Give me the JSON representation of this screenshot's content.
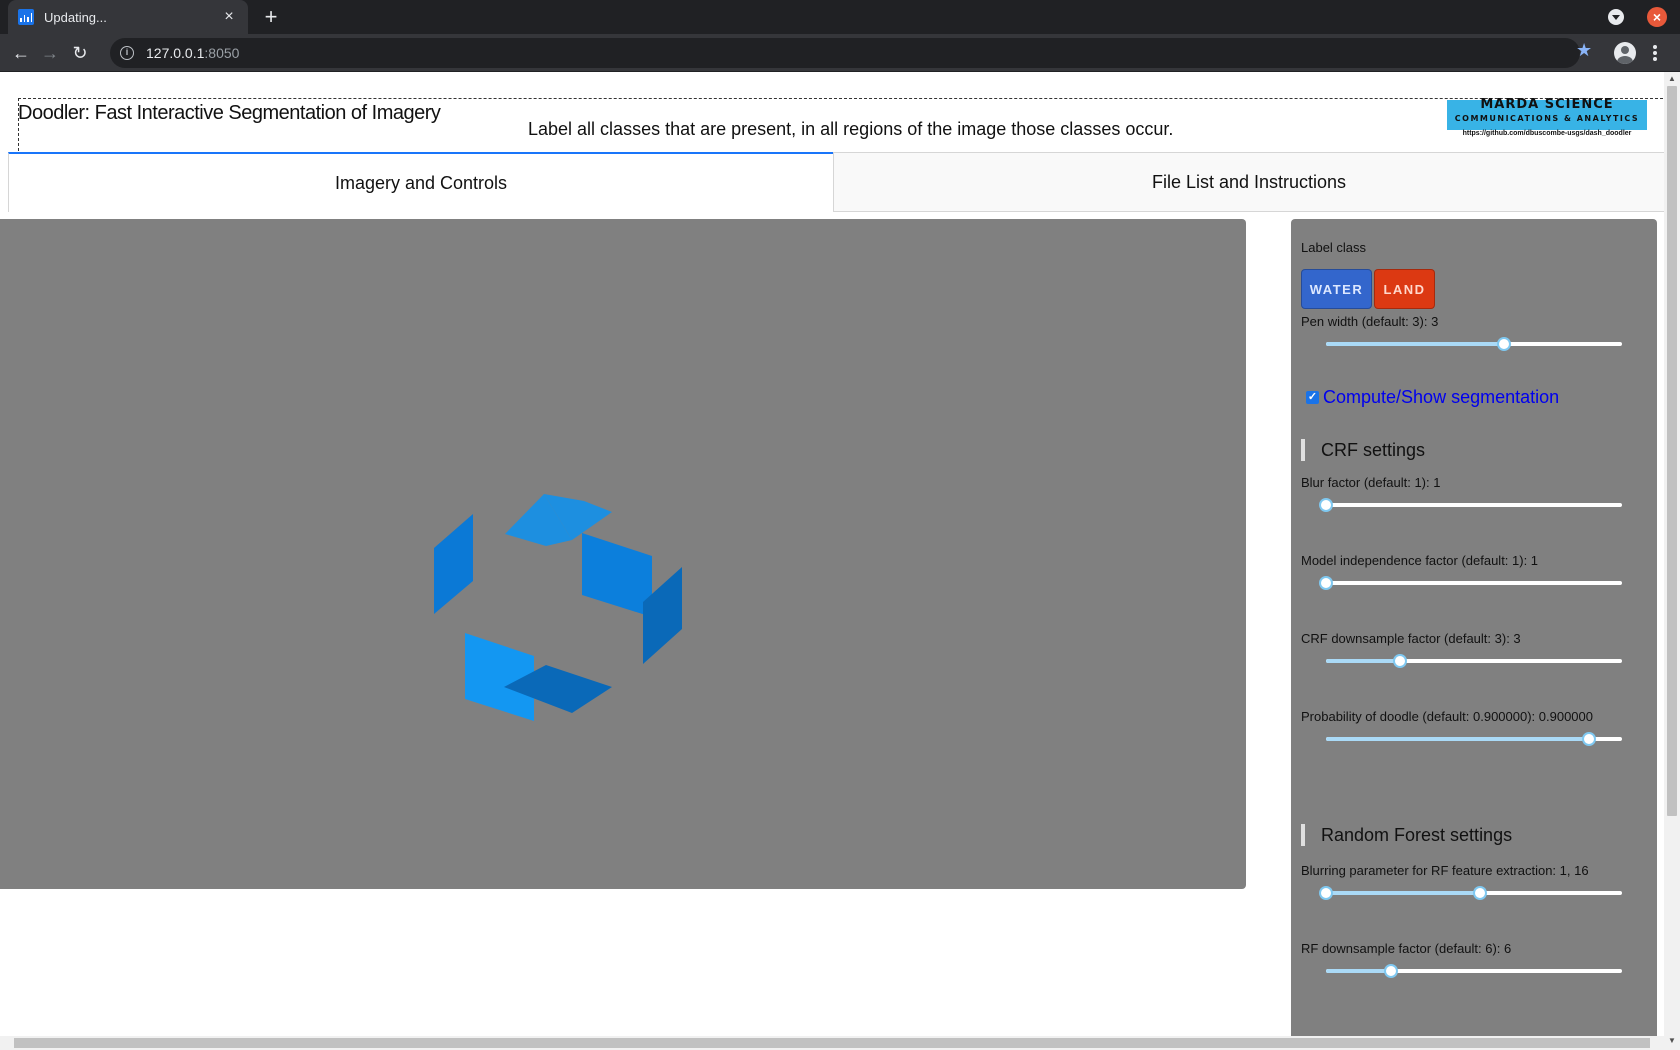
{
  "browser": {
    "tab_title": "Updating...",
    "tab_close": "×",
    "new_tab": "+",
    "url_host": "127.0.0.1",
    "url_port": ":8050",
    "window_close": "×"
  },
  "header": {
    "title": "Doodler: Fast Interactive Segmentation of Imagery",
    "instruction": "Label all classes that are present, in all regions of the image those classes occur.",
    "logo_title": "MARDA SCIENCE",
    "logo_subtitle": "COMMUNICATIONS & ANALYTICS",
    "logo_url": "https://github.com/dbuscombe-usgs/dash_doodler"
  },
  "tabs": [
    {
      "label": "Imagery and Controls",
      "active": true
    },
    {
      "label": "File List and Instructions",
      "active": false
    }
  ],
  "controls": {
    "label_class_title": "Label class",
    "classes": [
      {
        "label": "WATER",
        "color": "#3366cc"
      },
      {
        "label": "LAND",
        "color": "#dc3912"
      }
    ],
    "pen_width_label": "Pen width (default: 3): 3",
    "pen_width_fraction": 0.6,
    "segmentation_checked": true,
    "segmentation_label": "Compute/Show segmentation",
    "crf_heading": "CRF settings",
    "blur_label": "Blur factor (default: 1): 1",
    "blur_fraction": 0.0,
    "model_indep_label": "Model independence factor (default: 1): 1",
    "model_indep_fraction": 0.0,
    "crf_downsample_label": "CRF downsample factor (default: 3): 3",
    "crf_downsample_fraction": 0.25,
    "prob_doodle_label": "Probability of doodle (default: 0.900000): 0.900000",
    "prob_doodle_fraction": 0.89,
    "rf_heading": "Random Forest settings",
    "rf_blur_label": "Blurring parameter for RF feature extraction: 1, 16",
    "rf_blur_range": [
      0.0,
      0.52
    ],
    "rf_downsample_label": "RF downsample factor (default: 6): 6",
    "rf_downsample_fraction": 0.22
  },
  "loading_spinner": {
    "color": "#1d8fe0"
  }
}
